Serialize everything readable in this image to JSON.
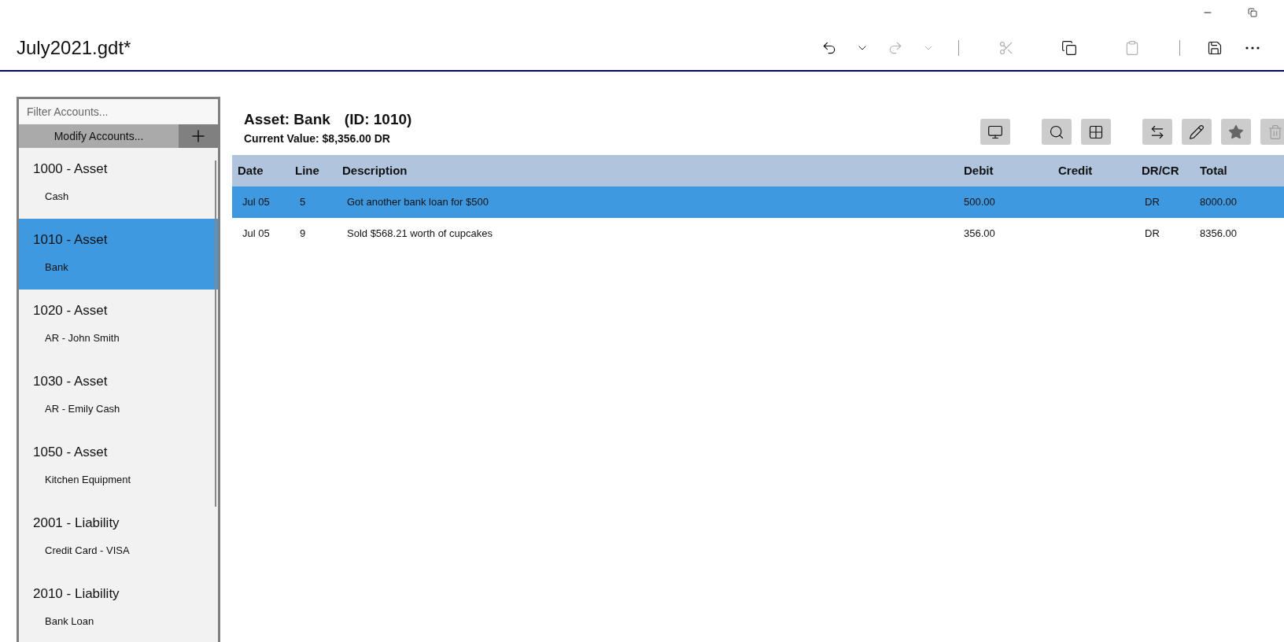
{
  "window": {
    "title": "July2021.gdt*"
  },
  "toolbar": [
    {
      "kind": "undo",
      "disabled": false
    },
    {
      "kind": "dropdown",
      "disabled": false
    },
    {
      "kind": "redo",
      "disabled": true
    },
    {
      "kind": "dropdown",
      "disabled": true
    },
    {
      "kind": "separator"
    },
    {
      "kind": "cut",
      "disabled": true
    },
    {
      "kind": "copy",
      "disabled": false
    },
    {
      "kind": "paste",
      "disabled": true
    },
    {
      "kind": "separator"
    },
    {
      "kind": "save",
      "disabled": false
    },
    {
      "kind": "more",
      "disabled": false
    }
  ],
  "sidebar": {
    "filter": {
      "placeholder": "Filter Accounts..."
    },
    "modify_button": "Modify Accounts...",
    "items": [
      {
        "title": "1000 - Asset",
        "name": "Cash",
        "selected": false
      },
      {
        "title": "1010 - Asset",
        "name": "Bank",
        "selected": true
      },
      {
        "title": "1020 - Asset",
        "name": "AR - John Smith",
        "selected": false
      },
      {
        "title": "1030 - Asset",
        "name": "AR - Emily Cash",
        "selected": false
      },
      {
        "title": "1050 - Asset",
        "name": "Kitchen Equipment",
        "selected": false
      },
      {
        "title": "2001 - Liability",
        "name": "Credit Card - VISA",
        "selected": false
      },
      {
        "title": "2010 - Liability",
        "name": "Bank Loan",
        "selected": false
      }
    ]
  },
  "account": {
    "title": "Asset: Bank",
    "id": "(ID: 1010)",
    "current_value": "Current Value: $8,356.00 DR"
  },
  "actions": [
    {
      "kind": "monitor",
      "disabled": false
    },
    {
      "kind": "search",
      "disabled": false
    },
    {
      "kind": "grid",
      "disabled": false
    },
    {
      "kind": "transfer",
      "disabled": false
    },
    {
      "kind": "edit",
      "disabled": false
    },
    {
      "kind": "star",
      "disabled": false
    },
    {
      "kind": "delete",
      "disabled": true
    }
  ],
  "table": {
    "columns": [
      "Date",
      "Line",
      "Description",
      "Debit",
      "Credit",
      "DR/CR",
      "Total"
    ],
    "rows": [
      {
        "cells": [
          "Jul 05",
          "5",
          "Got another bank loan for $500",
          "500.00",
          "",
          "DR",
          "8000.00"
        ],
        "selected": true
      },
      {
        "cells": [
          "Jul 05",
          "9",
          "Sold $568.21 worth of cupcakes",
          "356.00",
          "",
          "DR",
          "8356.00"
        ],
        "selected": false
      }
    ]
  }
}
